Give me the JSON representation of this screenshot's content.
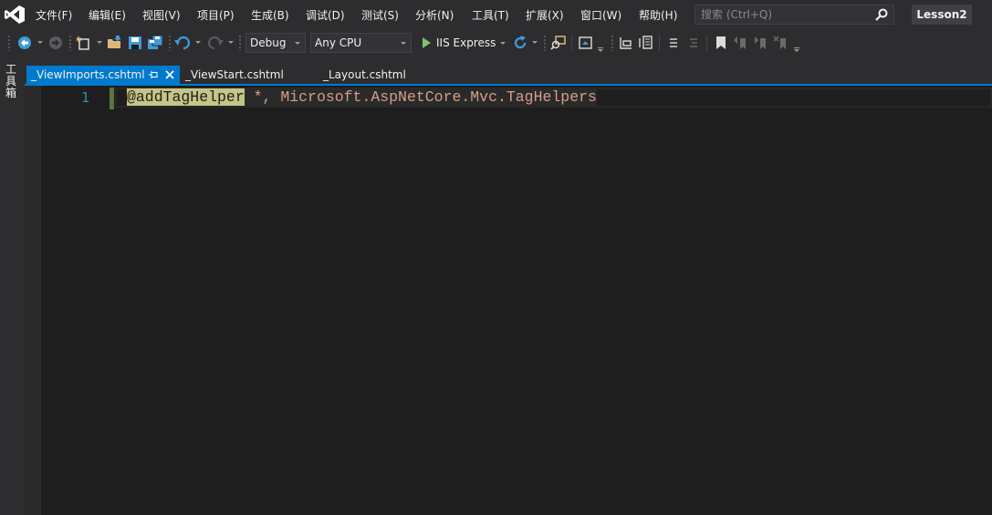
{
  "menu": {
    "items": [
      {
        "label": "文件(F)",
        "name": "menu-file"
      },
      {
        "label": "编辑(E)",
        "name": "menu-edit"
      },
      {
        "label": "视图(V)",
        "name": "menu-view"
      },
      {
        "label": "项目(P)",
        "name": "menu-project"
      },
      {
        "label": "生成(B)",
        "name": "menu-build"
      },
      {
        "label": "调试(D)",
        "name": "menu-debug"
      },
      {
        "label": "测试(S)",
        "name": "menu-test"
      },
      {
        "label": "分析(N)",
        "name": "menu-analyze"
      },
      {
        "label": "工具(T)",
        "name": "menu-tools"
      },
      {
        "label": "扩展(X)",
        "name": "menu-extensions"
      },
      {
        "label": "窗口(W)",
        "name": "menu-window"
      },
      {
        "label": "帮助(H)",
        "name": "menu-help"
      }
    ]
  },
  "search": {
    "placeholder": "搜索 (Ctrl+Q)"
  },
  "solution": {
    "name": "Lesson2"
  },
  "toolbar": {
    "configuration": "Debug",
    "platform": "Any CPU",
    "run_label": "IIS Express"
  },
  "left_strip": {
    "toolbox_label": "工具箱"
  },
  "tabs": [
    {
      "label": "_ViewImports.cshtml",
      "active": true
    },
    {
      "label": "_ViewStart.cshtml",
      "active": false
    },
    {
      "label": "_Layout.cshtml",
      "active": false
    }
  ],
  "editor": {
    "line_number": "1",
    "directive": "@addTagHelper",
    "rest": " *, Microsoft.AspNetCore.Mvc.TagHelpers"
  },
  "colors": {
    "accent": "#007acc",
    "line_number": "#2b91af",
    "string": "#d69d85",
    "directive_highlight": "#c5c587",
    "change_marker": "#57753f"
  },
  "icons": {
    "logo": "visual-studio-logo-icon",
    "search": "search-icon",
    "back": "navigate-back-icon",
    "forward": "navigate-forward-icon",
    "new_project": "new-project-icon",
    "open": "open-folder-icon",
    "save": "save-icon",
    "save_all": "save-all-icon",
    "undo": "undo-icon",
    "redo": "redo-icon",
    "run": "play-icon",
    "refresh": "refresh-icon",
    "pin": "pin-icon",
    "close": "close-icon"
  }
}
